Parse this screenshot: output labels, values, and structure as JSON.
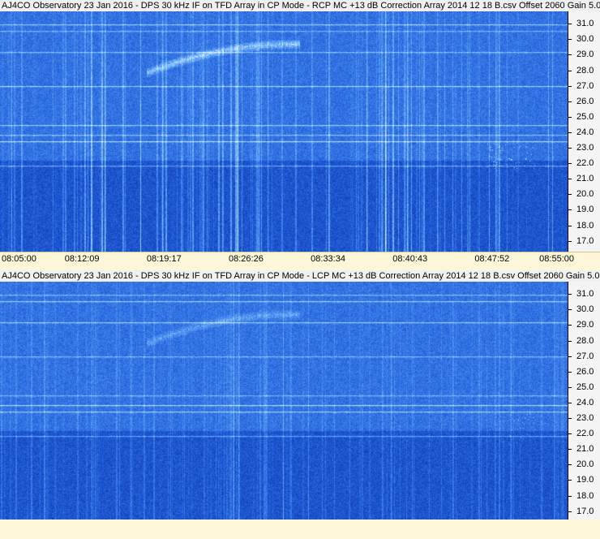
{
  "panels": [
    {
      "title": "AJ4CO Observatory 23 Jan 2016 - DPS 30 kHz IF on TFD Array in CP Mode - RCP  MC +13 dB  Correction Array 2014 12 18 B.csv  Offset 2060  Gain 5.0",
      "x_labels": [
        "08:05:00",
        "08:12:09",
        "08:19:17",
        "08:26:26",
        "08:33:34",
        "08:40:43",
        "08:47:52",
        "08:55:00"
      ]
    },
    {
      "title": "AJ4CO Observatory 23 Jan 2016 - DPS 30 kHz IF on TFD Array in CP Mode - LCP  MC +13 dB  Correction Array 2014 12 18 B.csv  Offset 2060  Gain 5.0",
      "x_labels": []
    }
  ],
  "chart_data": [
    {
      "type": "heatmap",
      "title": "AJ4CO Observatory 23 Jan 2016 - DPS 30 kHz IF on TFD Array in CP Mode - RCP  MC +13 dB  Correction Array 2014 12 18 B.csv  Offset 2060  Gain 5.0",
      "polarization": "RCP",
      "xlabel": "",
      "ylabel": "",
      "x_ticks": [
        "08:05:00",
        "08:12:09",
        "08:19:17",
        "08:26:26",
        "08:33:34",
        "08:40:43",
        "08:47:52",
        "08:55:00"
      ],
      "y_ticks": [
        31.0,
        30.0,
        29.0,
        28.0,
        27.0,
        26.0,
        25.0,
        24.0,
        23.0,
        22.0,
        21.0,
        20.0,
        19.0,
        18.0,
        17.0
      ],
      "ylim": [
        16.3,
        31.8
      ],
      "colormap": [
        "#0a2a9a",
        "#1e5ad6",
        "#4a90f0",
        "#9ad0ff",
        "#e8f6ff"
      ]
    },
    {
      "type": "heatmap",
      "title": "AJ4CO Observatory 23 Jan 2016 - DPS 30 kHz IF on TFD Array in CP Mode - LCP  MC +13 dB  Correction Array 2014 12 18 B.csv  Offset 2060  Gain 5.0",
      "polarization": "LCP",
      "xlabel": "",
      "ylabel": "",
      "x_ticks": [],
      "y_ticks": [
        31.0,
        30.0,
        29.0,
        28.0,
        27.0,
        26.0,
        25.0,
        24.0,
        23.0,
        22.0,
        21.0,
        20.0,
        19.0,
        18.0,
        17.0
      ],
      "ylim": [
        16.3,
        31.8
      ],
      "colormap": [
        "#0a2a9a",
        "#1e5ad6",
        "#4a90f0",
        "#9ad0ff",
        "#e8f6ff"
      ]
    }
  ]
}
